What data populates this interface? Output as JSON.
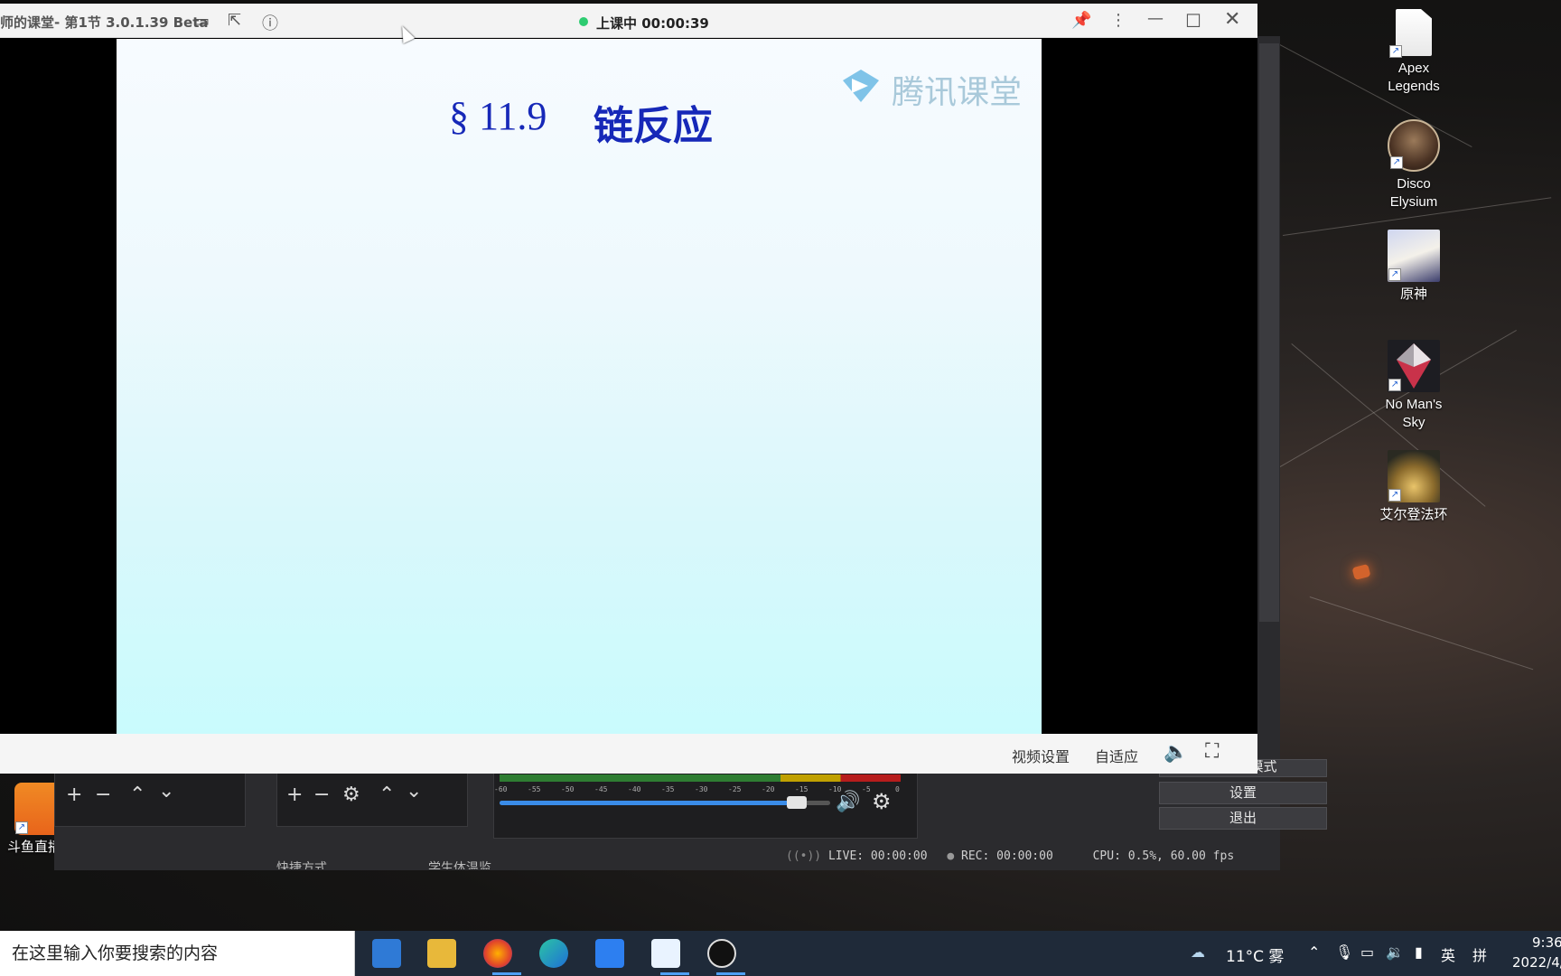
{
  "desktop": {
    "icons": [
      {
        "label": "Apex\nLegends",
        "icon": "file-icon"
      },
      {
        "label": "Disco\nElysium",
        "icon": "portrait-icon"
      },
      {
        "label": "原神",
        "icon": "anime-girl-icon"
      },
      {
        "label": "No Man's\nSky",
        "icon": "diamond-icon"
      },
      {
        "label": "艾尔登法环",
        "icon": "elden-ring-icon"
      }
    ],
    "left_icon": {
      "label": "斗鱼直播"
    }
  },
  "tencent_window": {
    "title": "师的课堂- 第1节 3.0.1.39 Beta",
    "status": "上课中 00:00:39",
    "status_color": "#2ecc71",
    "slide": {
      "heading_num": "§ 11.9",
      "heading_text": "链反应",
      "watermark": "腾讯课堂"
    },
    "bottom": {
      "video_settings": "视频设置",
      "fit": "自适应"
    }
  },
  "obs": {
    "buttons": {
      "settings": "设置",
      "exit": "退出",
      "studio_mode": "工作室模式"
    },
    "status": {
      "live": "LIVE: 00:00:00",
      "rec": "REC: 00:00:00",
      "cpu": "CPU: 0.5%, 60.00 fps"
    },
    "partial_labels": {
      "a": "快捷方式",
      "b": "学生体温监..."
    },
    "meter_ticks": [
      "-60",
      "-55",
      "-50",
      "-45",
      "-40",
      "-35",
      "-30",
      "-25",
      "-20",
      "-15",
      "-10",
      "-5",
      "0"
    ],
    "volume_fraction": 0.9
  },
  "taskbar": {
    "search_placeholder": "在这里输入你要搜索的内容",
    "weather": "11°C 雾",
    "ime1": "英",
    "ime2": "拼",
    "time": "9:36",
    "date": "2022/4/"
  }
}
